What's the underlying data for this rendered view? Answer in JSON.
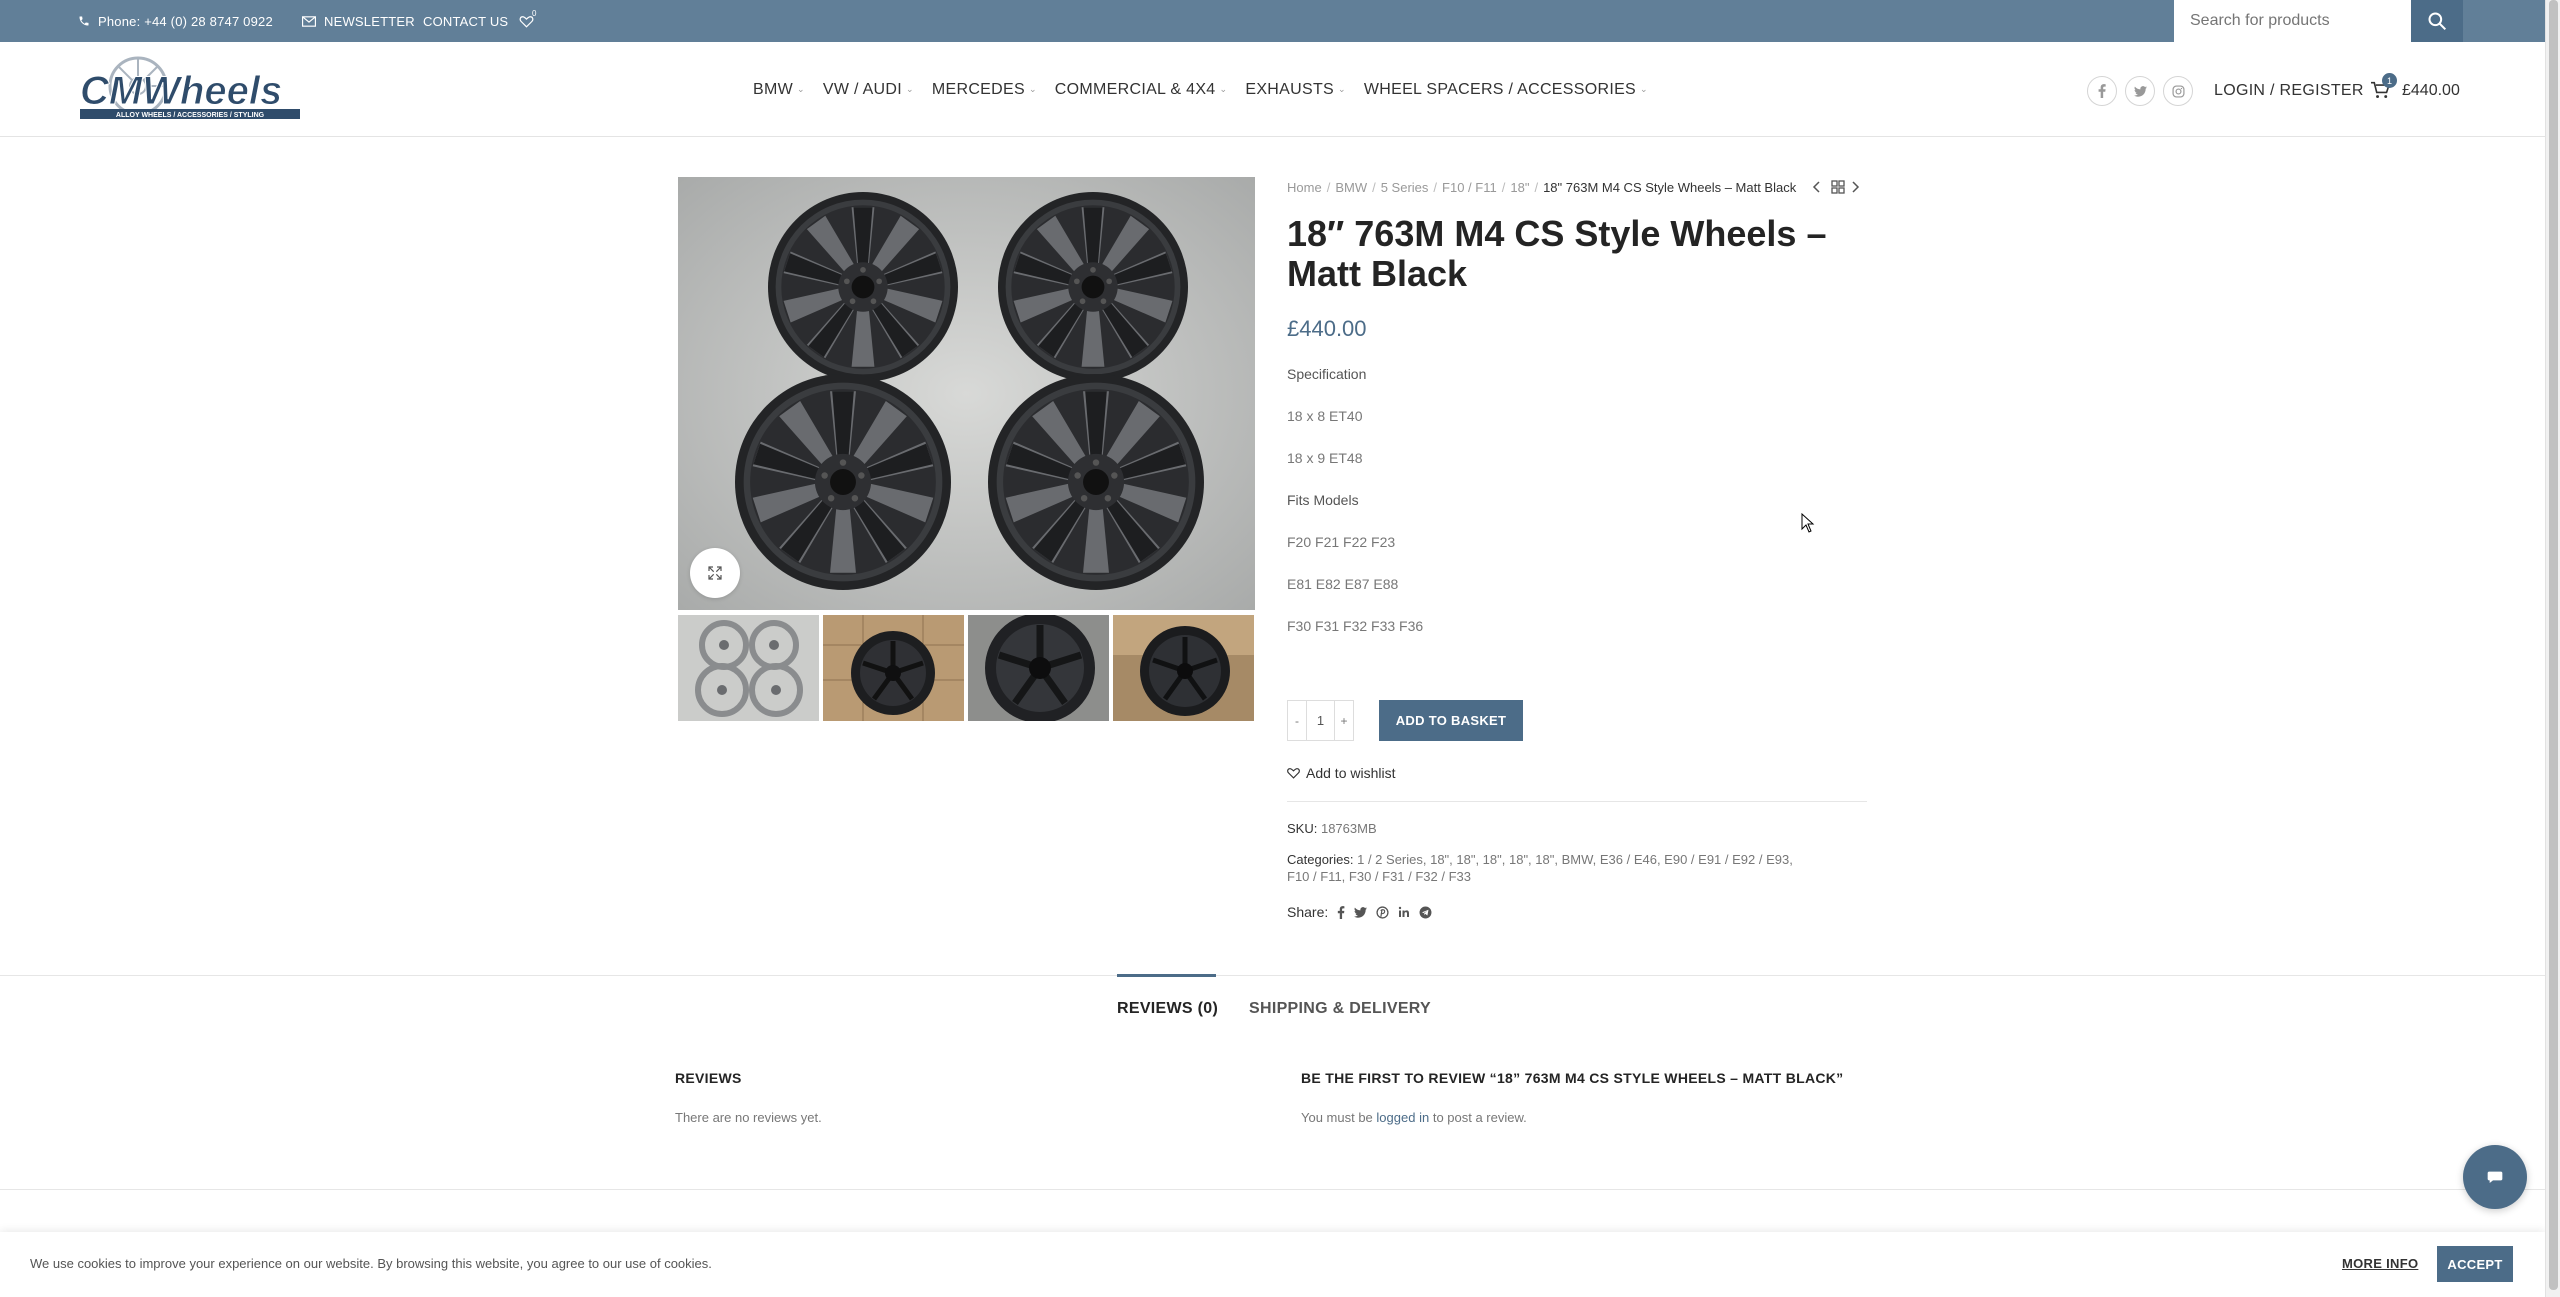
{
  "topbar": {
    "phone": "Phone: +44 (0) 28 8747 0922",
    "newsletter": "NEWSLETTER",
    "contact": "CONTACT US",
    "wishlist_count": "0",
    "search_placeholder": "Search for products"
  },
  "header": {
    "logo_text": "CMWheels",
    "logo_tagline": "ALLOY WHEELS / ACCESSORIES / STYLING",
    "nav": [
      {
        "label": "BMW"
      },
      {
        "label": "VW / AUDI"
      },
      {
        "label": "MERCEDES"
      },
      {
        "label": "COMMERCIAL & 4X4"
      },
      {
        "label": "EXHAUSTS"
      },
      {
        "label": "WHEEL SPACERS / ACCESSORIES"
      }
    ],
    "login": "LOGIN / REGISTER",
    "cart_count": "1",
    "cart_total": "£440.00"
  },
  "breadcrumb": [
    "Home",
    "BMW",
    "5 Series",
    "F10 / F11",
    "18\""
  ],
  "breadcrumb_current": "18\" 763M M4 CS Style Wheels – Matt Black",
  "product": {
    "title": "18″ 763M M4 CS Style Wheels – Matt Black",
    "price": "£440.00",
    "description": [
      {
        "text": "Specification",
        "bold": true
      },
      {
        "text": "18 x 8 ET40"
      },
      {
        "text": "18 x 9 ET48"
      },
      {
        "text": "Fits Models",
        "bold": true
      },
      {
        "text": "F20 F21 F22 F23"
      },
      {
        "text": "E81 E82 E87 E88"
      },
      {
        "text": "F30 F31 F32 F33 F36"
      }
    ],
    "qty_minus": "-",
    "qty_value": "1",
    "qty_plus": "+",
    "add_to_basket": "ADD TO BASKET",
    "add_to_wishlist": "Add to wishlist",
    "sku_label": "SKU:",
    "sku": "18763MB",
    "categories_label": "Categories:",
    "categories_line1": "1 / 2 Series, 18\", 18\", 18\", 18\", 18\", BMW, E36 / E46, E90 / E91 / E92 / E93,",
    "categories_line2": "F10 / F11, F30 / F31 / F32 / F33",
    "share_label": "Share:"
  },
  "tabs": [
    {
      "label": "REVIEWS (0)",
      "active": true
    },
    {
      "label": "SHIPPING & DELIVERY",
      "active": false
    }
  ],
  "reviews": {
    "heading": "REVIEWS",
    "empty": "There are no reviews yet.",
    "form_heading": "BE THE FIRST TO REVIEW “18” 763M M4 CS STYLE WHEELS – MATT BLACK”",
    "must_be": "You must be",
    "logged_in": "logged in",
    "to_post": "to post a review."
  },
  "cookie": {
    "text": "We use cookies to improve your experience on our website. By browsing this website, you agree to our use of cookies.",
    "more_info": "MORE INFO",
    "accept": "ACCEPT"
  },
  "colors": {
    "primary": "#4c6c88",
    "topbar": "#617f98"
  }
}
